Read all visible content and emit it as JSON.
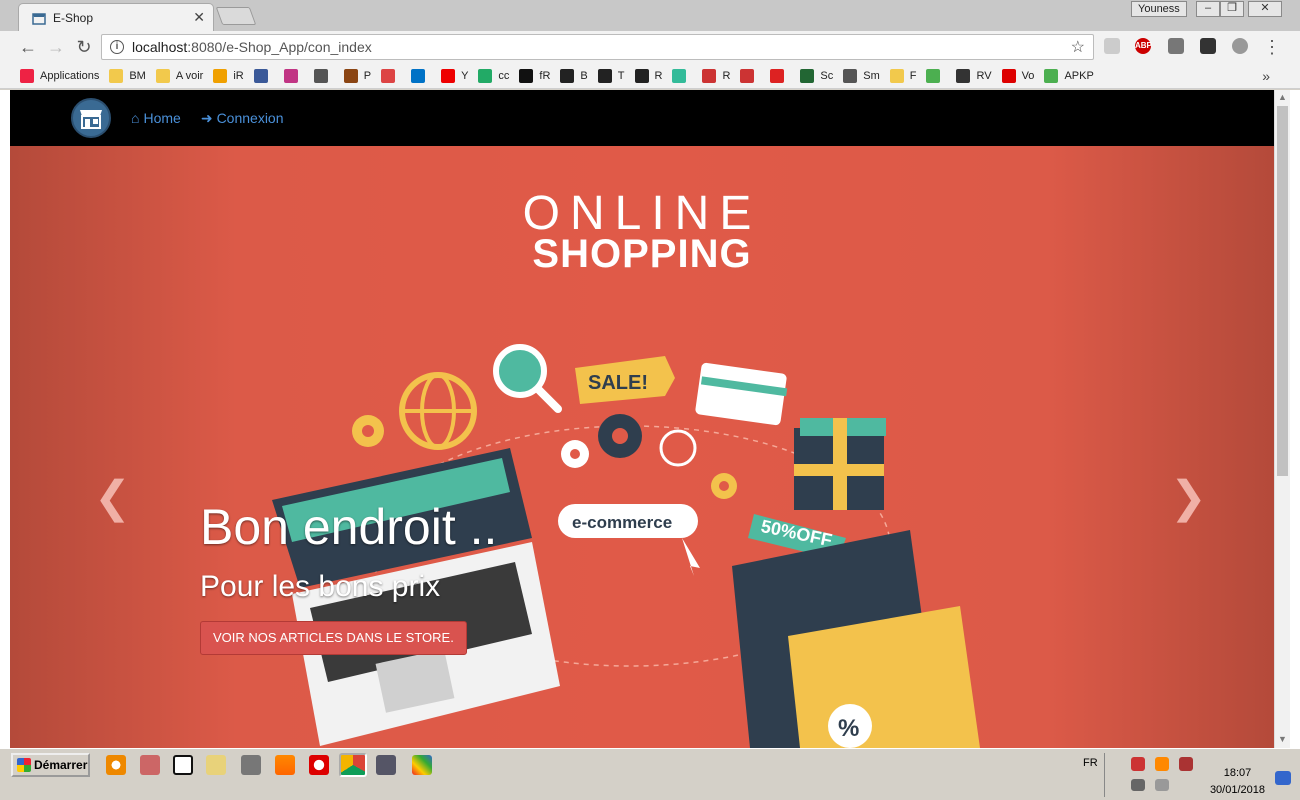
{
  "browser": {
    "tab_title": "E-Shop",
    "tab_close": "✕",
    "user_name": "Youness",
    "window_controls": [
      "–",
      "❐",
      "✕"
    ],
    "url_host": "localhost",
    "url_path": ":8080/e-Shop_App/con_index",
    "back": "←",
    "forward": "→",
    "reload": "↻",
    "bookmark_star": "☆",
    "menu": "⋮"
  },
  "bookmarks": [
    {
      "label": "Applications",
      "color": "#e24"
    },
    {
      "label": "BM",
      "color": "#f2c94c"
    },
    {
      "label": "A voir",
      "color": "#f2c94c"
    },
    {
      "label": "iR",
      "color": "#f0a000"
    },
    {
      "label": "",
      "color": "#3b5998"
    },
    {
      "label": "",
      "color": "#c13584"
    },
    {
      "label": "",
      "color": "#555"
    },
    {
      "label": "P",
      "color": "#8b4513"
    },
    {
      "label": "",
      "color": "#d44"
    },
    {
      "label": "",
      "color": "#0072c6"
    },
    {
      "label": "Y",
      "color": "#e00"
    },
    {
      "label": "cc",
      "color": "#2a6"
    },
    {
      "label": "fR",
      "color": "#111"
    },
    {
      "label": "B",
      "color": "#222"
    },
    {
      "label": "T",
      "color": "#222"
    },
    {
      "label": "R",
      "color": "#222"
    },
    {
      "label": "",
      "color": "#3b9"
    },
    {
      "label": "R",
      "color": "#c33"
    },
    {
      "label": "",
      "color": "#c33"
    },
    {
      "label": "",
      "color": "#d22"
    },
    {
      "label": "Sc",
      "color": "#263"
    },
    {
      "label": "Sm",
      "color": "#555"
    },
    {
      "label": "F",
      "color": "#f2c94c"
    },
    {
      "label": "",
      "color": "#4caf50"
    },
    {
      "label": "RV",
      "color": "#333"
    },
    {
      "label": "Vo",
      "color": "#d00"
    },
    {
      "label": "APKP",
      "color": "#4caf50"
    }
  ],
  "bookmarks_more": "»",
  "site": {
    "nav_home": "Home",
    "nav_login": "Connexion",
    "hero_line1": "ONLINE",
    "hero_line2": "SHOPPING",
    "caption_heading": "Bon endroit ..",
    "caption_sub": "Pour les bons prix",
    "cta_label": "VOIR NOS ARTICLES DANS LE STORE.",
    "prev_arrow": "❮",
    "next_arrow": "❯",
    "badge_sale": "SALE!",
    "badge_ecommerce": "e-commerce",
    "badge_offer": "50%OFF",
    "badge_percent": "%"
  },
  "taskbar": {
    "start_label": "Démarrer",
    "language": "FR",
    "time": "18:07",
    "date": "30/01/2018"
  },
  "colors": {
    "nav_link": "#4a90d9",
    "hero_bg": "#e05a48",
    "cta_bg": "#d9534f"
  }
}
